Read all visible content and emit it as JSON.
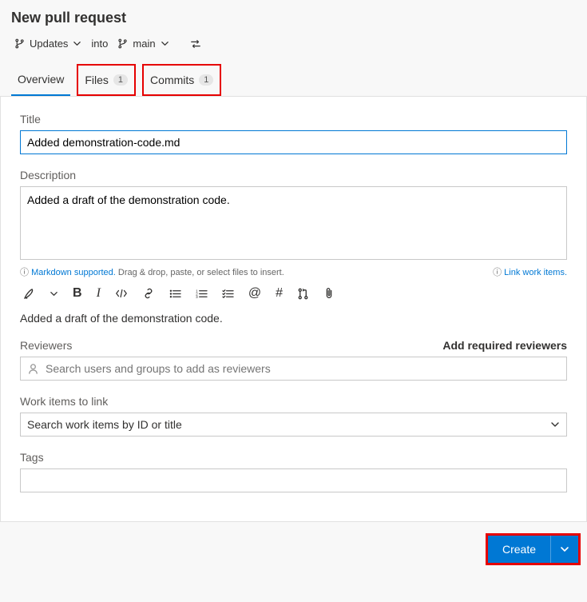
{
  "header": {
    "title": "New pull request",
    "source_branch": "Updates",
    "into": "into",
    "target_branch": "main"
  },
  "tabs": {
    "overview": "Overview",
    "files": "Files",
    "files_count": "1",
    "commits": "Commits",
    "commits_count": "1"
  },
  "form": {
    "title_label": "Title",
    "title_value": "Added demonstration-code.md",
    "description_label": "Description",
    "description_value": "Added a draft of the demonstration code.",
    "markdown_hint": "Markdown supported.",
    "drag_hint": " Drag & drop, paste, or select files to insert.",
    "link_work_items": "Link work items.",
    "preview": "Added a draft of the demonstration code.",
    "reviewers_label": "Reviewers",
    "add_required": "Add required reviewers",
    "reviewers_placeholder": "Search users and groups to add as reviewers",
    "workitems_label": "Work items to link",
    "workitems_placeholder": "Search work items by ID or title",
    "tags_label": "Tags"
  },
  "footer": {
    "create": "Create"
  }
}
